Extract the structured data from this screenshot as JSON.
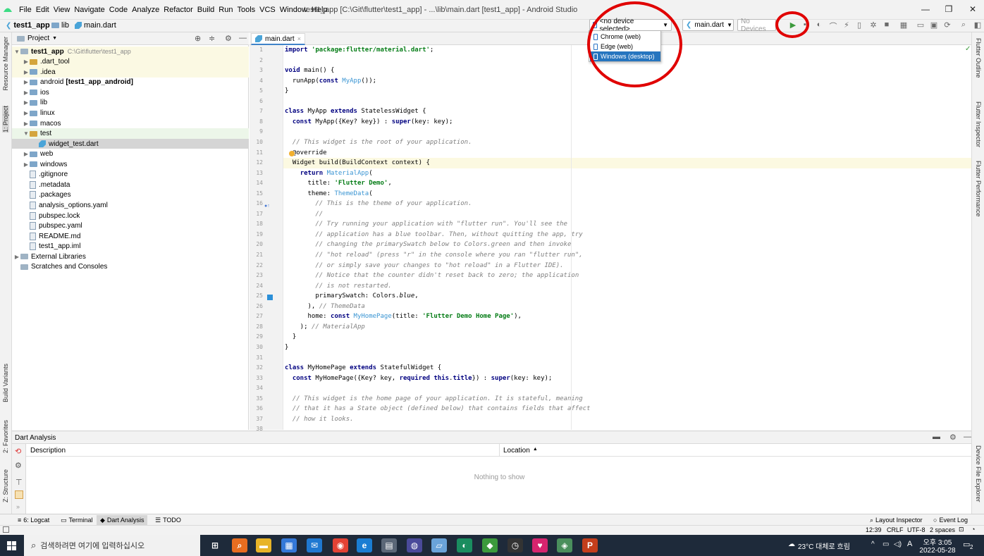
{
  "window": {
    "title": "test1_app [C:\\Git\\flutter\\test1_app] - ...\\lib\\main.dart [test1_app] - Android Studio",
    "menus": [
      "File",
      "Edit",
      "View",
      "Navigate",
      "Code",
      "Analyze",
      "Refactor",
      "Build",
      "Run",
      "Tools",
      "VCS",
      "Window",
      "Help"
    ]
  },
  "breadcrumbs": {
    "project": "test1_app",
    "folder": "lib",
    "file": "main.dart"
  },
  "toolbar": {
    "device_selector": "<no device selected>",
    "run_config": "main.dart",
    "devices_label": "No Devices"
  },
  "device_menu": {
    "items": [
      {
        "label": "Chrome (web)"
      },
      {
        "label": "Edge (web)"
      },
      {
        "label": "Windows (desktop)"
      }
    ],
    "selected": "Windows (desktop)"
  },
  "left_strip": {
    "resource_manager": "Resource Manager",
    "project": "1: Project",
    "build_variants": "Build Variants",
    "favorites": "2: Favorites",
    "structure": "Z: Structure"
  },
  "right_strip": {
    "flutter_outline": "Flutter Outline",
    "flutter_inspector": "Flutter Inspector",
    "flutter_performance": "Flutter Performance",
    "device_file_explorer": "Device File Explorer"
  },
  "project_panel": {
    "title": "Project",
    "root_name": "test1_app",
    "root_path": "C:\\Git\\flutter\\test1_app",
    "items": [
      {
        "label": ".dart_tool"
      },
      {
        "label": ".idea"
      },
      {
        "label": "android",
        "suffix": "[test1_app_android]"
      },
      {
        "label": "ios"
      },
      {
        "label": "lib"
      },
      {
        "label": "linux"
      },
      {
        "label": "macos"
      },
      {
        "label": "test"
      },
      {
        "label": "widget_test.dart"
      },
      {
        "label": "web"
      },
      {
        "label": "windows"
      },
      {
        "label": ".gitignore"
      },
      {
        "label": ".metadata"
      },
      {
        "label": ".packages"
      },
      {
        "label": "analysis_options.yaml"
      },
      {
        "label": "pubspec.lock"
      },
      {
        "label": "pubspec.yaml"
      },
      {
        "label": "README.md"
      },
      {
        "label": "test1_app.iml"
      },
      {
        "label": "External Libraries"
      },
      {
        "label": "Scratches and Consoles"
      }
    ]
  },
  "editor": {
    "tab": "main.dart",
    "current_line": 12,
    "lines": [
      {
        "n": "1",
        "html": "<span class='kw'>import</span> <span class='st'>'package:flutter/material.dart'</span>;"
      },
      {
        "n": "2",
        "html": ""
      },
      {
        "n": "3",
        "html": "<span class='kw'>void</span> main() {"
      },
      {
        "n": "4",
        "html": "  runApp(<span class='kw'>const</span> <span class='cls'>MyApp</span>());"
      },
      {
        "n": "5",
        "html": "}"
      },
      {
        "n": "6",
        "html": ""
      },
      {
        "n": "7",
        "html": "<span class='kw'>class</span> MyApp <span class='kw'>extends</span> StatelessWidget {"
      },
      {
        "n": "8",
        "html": "  <span class='kw'>const</span> MyApp({Key? key}) : <span class='kw'>super</span>(key: key);"
      },
      {
        "n": "9",
        "html": ""
      },
      {
        "n": "10",
        "html": "  <span class='cm'>// This widget is the root of your application.</span>"
      },
      {
        "n": "11",
        "html": "  @override"
      },
      {
        "n": "12",
        "html": "  Widget build(BuildContext context) {"
      },
      {
        "n": "13",
        "html": "    <span class='kw'>return</span> <span class='cls'>MaterialApp</span>("
      },
      {
        "n": "14",
        "html": "      title: <span class='st'>'Flutter Demo'</span>,"
      },
      {
        "n": "15",
        "html": "      theme: <span class='cls'>ThemeData</span>("
      },
      {
        "n": "16",
        "html": "        <span class='cm'>// This is the theme of your application.</span>"
      },
      {
        "n": "17",
        "html": "        <span class='cm'>//</span>"
      },
      {
        "n": "18",
        "html": "        <span class='cm'>// Try running your application with \"flutter run\". You'll see the</span>"
      },
      {
        "n": "19",
        "html": "        <span class='cm'>// application has a blue toolbar. Then, without quitting the app, try</span>"
      },
      {
        "n": "20",
        "html": "        <span class='cm'>// changing the primarySwatch below to Colors.green and then invoke</span>"
      },
      {
        "n": "21",
        "html": "        <span class='cm'>// \"hot reload\" (press \"r\" in the console where you ran \"flutter run\",</span>"
      },
      {
        "n": "22",
        "html": "        <span class='cm'>// or simply save your changes to \"hot reload\" in a Flutter IDE).</span>"
      },
      {
        "n": "23",
        "html": "        <span class='cm'>// Notice that the counter didn't reset back to zero; the application</span>"
      },
      {
        "n": "24",
        "html": "        <span class='cm'>// is not restarted.</span>"
      },
      {
        "n": "25",
        "html": "        primarySwatch: Colors.<span class='blue'>blue</span>,"
      },
      {
        "n": "26",
        "html": "      ), <span class='cm'>// ThemeData</span>"
      },
      {
        "n": "27",
        "html": "      home: <span class='kw'>const</span> <span class='cls'>MyHomePage</span>(title: <span class='st'>'Flutter Demo Home Page'</span>),"
      },
      {
        "n": "28",
        "html": "    ); <span class='cm'>// MaterialApp</span>"
      },
      {
        "n": "29",
        "html": "  }"
      },
      {
        "n": "30",
        "html": "}"
      },
      {
        "n": "31",
        "html": ""
      },
      {
        "n": "32",
        "html": "<span class='kw'>class</span> MyHomePage <span class='kw'>extends</span> StatefulWidget {"
      },
      {
        "n": "33",
        "html": "  <span class='kw'>const</span> MyHomePage({Key? key, <span class='kw'>required</span> <span class='kw'>this</span>.<span class='kw'>title</span>}) : <span class='kw'>super</span>(key: key);"
      },
      {
        "n": "34",
        "html": ""
      },
      {
        "n": "35",
        "html": "  <span class='cm'>// This widget is the home page of your application. It is stateful, meaning</span>"
      },
      {
        "n": "36",
        "html": "  <span class='cm'>// that it has a State object (defined below) that contains fields that affect</span>"
      },
      {
        "n": "37",
        "html": "  <span class='cm'>// how it looks.</span>"
      },
      {
        "n": "38",
        "html": ""
      }
    ]
  },
  "dart_analysis": {
    "title": "Dart Analysis",
    "col_description": "Description",
    "col_location": "Location",
    "empty": "Nothing to show"
  },
  "bottom_tabs": [
    {
      "label": "6: Logcat"
    },
    {
      "label": "Terminal"
    },
    {
      "label": "Dart Analysis",
      "active": true
    },
    {
      "label": "TODO"
    }
  ],
  "bottom_right_tabs": [
    {
      "label": "Layout Inspector"
    },
    {
      "label": "Event Log"
    }
  ],
  "status": {
    "position": "12:39",
    "line_sep": "CRLF",
    "encoding": "UTF-8",
    "indent": "2 spaces"
  },
  "taskbar": {
    "search_placeholder": "검색하려면 여기에 입력하십시오",
    "weather": "23°C 대체로 흐림",
    "ime": "A",
    "time": "오후 3:05",
    "date": "2022-05-28",
    "notifications": "2"
  },
  "colors": {
    "accent": "#2675bf",
    "annotation": "#e00000",
    "run": "#3c9a3c"
  }
}
